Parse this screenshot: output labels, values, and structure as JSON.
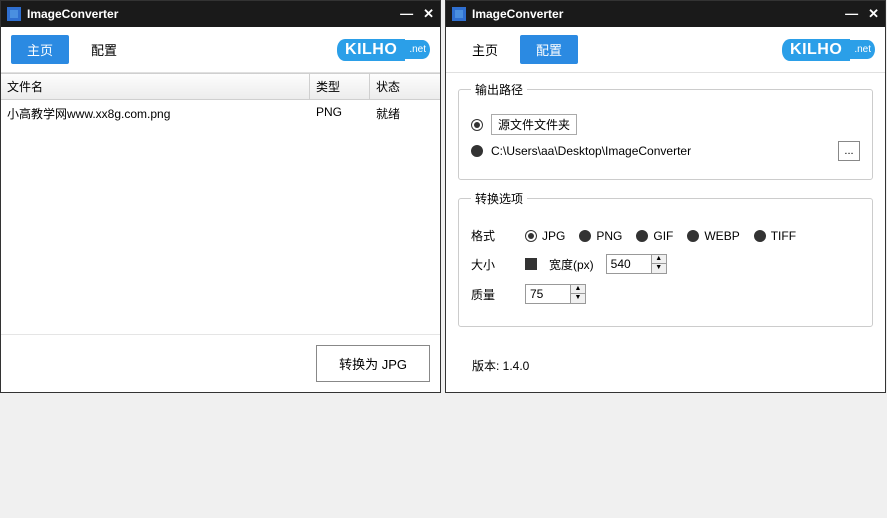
{
  "app": {
    "title": "ImageConverter"
  },
  "tabs": {
    "home": "主页",
    "config": "配置"
  },
  "logo": {
    "main": "KILHO",
    "suffix": ".net"
  },
  "table": {
    "headers": {
      "name": "文件名",
      "type": "类型",
      "status": "状态"
    },
    "rows": [
      {
        "name": "小高教学网www.xx8g.com.png",
        "type": "PNG",
        "status": "就绪"
      }
    ]
  },
  "convert_button": "转换为 JPG",
  "output": {
    "legend": "输出路径",
    "source_label": "源文件文件夹",
    "path": "C:\\Users\\aa\\Desktop\\ImageConverter",
    "browse": "..."
  },
  "options": {
    "legend": "转换选项",
    "format_label": "格式",
    "formats": [
      "JPG",
      "PNG",
      "GIF",
      "WEBP",
      "TIFF"
    ],
    "size_label": "大小",
    "width_label": "宽度(px)",
    "width_value": "540",
    "quality_label": "质量",
    "quality_value": "75"
  },
  "version": "版本: 1.4.0"
}
